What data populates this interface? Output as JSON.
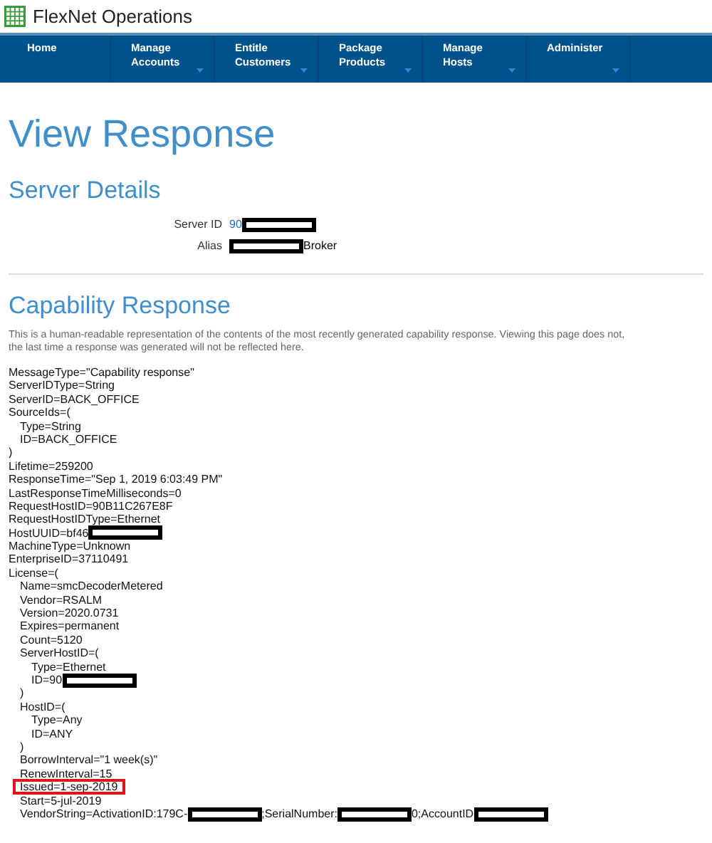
{
  "app": {
    "title": "FlexNet Operations"
  },
  "nav": [
    {
      "label": "Home",
      "has_menu": false
    },
    {
      "label": "Manage Accounts",
      "has_menu": true
    },
    {
      "label": "Entitle Customers",
      "has_menu": true
    },
    {
      "label": "Package Products",
      "has_menu": true
    },
    {
      "label": "Manage Hosts",
      "has_menu": true
    },
    {
      "label": "Administer",
      "has_menu": true
    }
  ],
  "page_title": "View Response",
  "server_details": {
    "heading": "Server Details",
    "fields": [
      {
        "label": "Server ID",
        "segments": [
          {
            "kind": "link",
            "text": "90"
          },
          {
            "kind": "redaction"
          }
        ]
      },
      {
        "label": "Alias",
        "segments": [
          {
            "kind": "redaction"
          },
          {
            "kind": "text",
            "text": "Broker"
          }
        ]
      }
    ]
  },
  "capability": {
    "heading": "Capability Response",
    "description": [
      "This is a human-readable representation of the contents of the most recently generated capability response. Viewing this page does not,",
      "the last time a response was generated will not be reflected here."
    ],
    "lines": [
      {
        "segments": [
          {
            "kind": "text",
            "text": "MessageType=\"Capability response\""
          }
        ]
      },
      {
        "segments": [
          {
            "kind": "text",
            "text": "ServerIDType=String"
          }
        ]
      },
      {
        "segments": [
          {
            "kind": "text",
            "text": "ServerID=BACK_OFFICE"
          }
        ]
      },
      {
        "segments": [
          {
            "kind": "text",
            "text": "SourceIds=("
          }
        ],
        "closing": ")",
        "children": [
          {
            "segments": [
              {
                "kind": "text",
                "text": "Type=String"
              }
            ]
          },
          {
            "segments": [
              {
                "kind": "text",
                "text": "ID=BACK_OFFICE"
              }
            ]
          }
        ]
      },
      {
        "segments": [
          {
            "kind": "text",
            "text": "Lifetime=259200"
          }
        ]
      },
      {
        "segments": [
          {
            "kind": "text",
            "text": "ResponseTime=\"Sep 1, 2019 6:03:49 PM\""
          }
        ]
      },
      {
        "segments": [
          {
            "kind": "text",
            "text": "LastResponseTimeMilliseconds=0"
          }
        ]
      },
      {
        "segments": [
          {
            "kind": "text",
            "text": "RequestHostID=90B11C267E8F"
          }
        ]
      },
      {
        "segments": [
          {
            "kind": "text",
            "text": "RequestHostIDType=Ethernet"
          }
        ]
      },
      {
        "segments": [
          {
            "kind": "text",
            "text": "HostUUID=bf46"
          },
          {
            "kind": "redaction"
          }
        ]
      },
      {
        "segments": [
          {
            "kind": "text",
            "text": "MachineType=Unknown"
          }
        ]
      },
      {
        "segments": [
          {
            "kind": "text",
            "text": "EnterpriseID=37110491"
          }
        ]
      },
      {
        "segments": [
          {
            "kind": "text",
            "text": "License=("
          }
        ],
        "children": [
          {
            "segments": [
              {
                "kind": "text",
                "text": "Name=smcDecoderMetered"
              }
            ]
          },
          {
            "segments": [
              {
                "kind": "text",
                "text": "Vendor=RSALM"
              }
            ]
          },
          {
            "segments": [
              {
                "kind": "text",
                "text": "Version=2020.0731"
              }
            ]
          },
          {
            "segments": [
              {
                "kind": "text",
                "text": "Expires=permanent"
              }
            ]
          },
          {
            "segments": [
              {
                "kind": "text",
                "text": "Count=5120"
              }
            ]
          },
          {
            "segments": [
              {
                "kind": "text",
                "text": "ServerHostID=("
              }
            ],
            "closing": ")",
            "children": [
              {
                "segments": [
                  {
                    "kind": "text",
                    "text": "Type=Ethernet"
                  }
                ]
              },
              {
                "segments": [
                  {
                    "kind": "text",
                    "text": "ID=90"
                  },
                  {
                    "kind": "redaction"
                  }
                ]
              }
            ]
          },
          {
            "segments": [
              {
                "kind": "text",
                "text": "HostID=("
              }
            ],
            "closing": ")",
            "children": [
              {
                "segments": [
                  {
                    "kind": "text",
                    "text": "Type=Any"
                  }
                ]
              },
              {
                "segments": [
                  {
                    "kind": "text",
                    "text": "ID=ANY"
                  }
                ]
              }
            ]
          },
          {
            "segments": [
              {
                "kind": "text",
                "text": "BorrowInterval=\"1 week(s)\""
              }
            ]
          },
          {
            "segments": [
              {
                "kind": "text",
                "text": "RenewInterval=15"
              }
            ]
          },
          {
            "segments": [
              {
                "kind": "text",
                "text": "Issued=1-sep-2019"
              }
            ],
            "highlighted": true
          },
          {
            "segments": [
              {
                "kind": "text",
                "text": "Start=5-jul-2019"
              }
            ]
          },
          {
            "segments": [
              {
                "kind": "text",
                "text": "VendorString=ActivationID:179C-"
              },
              {
                "kind": "redaction"
              },
              {
                "kind": "text",
                "text": ";SerialNumber:"
              },
              {
                "kind": "redaction"
              },
              {
                "kind": "text",
                "text": "0;AccountID"
              },
              {
                "kind": "redaction"
              }
            ]
          }
        ]
      }
    ]
  }
}
